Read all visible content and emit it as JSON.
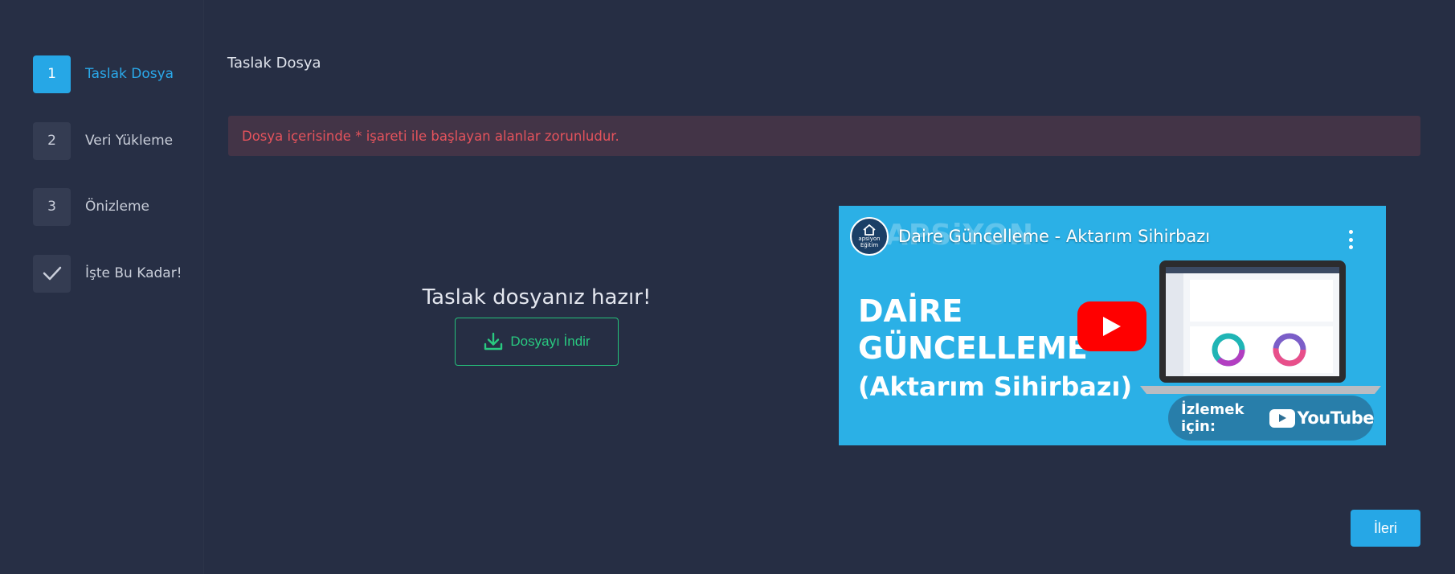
{
  "steps": [
    {
      "num": "1",
      "label": "Taslak Dosya",
      "active": true
    },
    {
      "num": "2",
      "label": "Veri Yükleme",
      "active": false
    },
    {
      "num": "3",
      "label": "Önizleme",
      "active": false
    },
    {
      "num": "",
      "label": "İşte Bu Kadar!",
      "active": false,
      "icon": "check-icon"
    }
  ],
  "main": {
    "title": "Taslak Dosya",
    "alert": "Dosya içerisinde * işareti ile başlayan alanlar zorunludur.",
    "ready_text": "Taslak dosyanız hazır!",
    "download_label": "Dosyayı İndir"
  },
  "video": {
    "channel_line1": "apsiyon",
    "channel_line2": "Eğitim",
    "watermark": "APSiYON",
    "title": "Daire Güncelleme - Aktarım Sihirbazı",
    "heading_line1": "DAİRE",
    "heading_line2": "GÜNCELLEME",
    "heading_line3": "(Aktarım Sihirbazı)",
    "watch_label": "İzlemek için:",
    "youtube_word": "YouTube"
  },
  "footer": {
    "next_label": "İleri"
  },
  "colors": {
    "accent": "#26a7e6",
    "success": "#25c07a",
    "danger": "#e5535c",
    "background": "#262e44"
  }
}
